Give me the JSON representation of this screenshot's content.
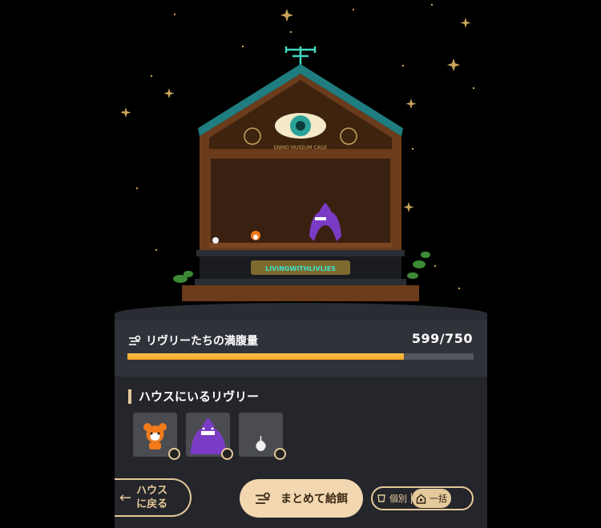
{
  "scene": {
    "sign_text": "LIVINGWITHLIVLIES",
    "house_header_text": "ENMEI MUSEUM CAGE"
  },
  "satiety": {
    "label": "リヴリーたちの満腹量",
    "value_text": "599/750",
    "current": 599,
    "max": 750,
    "icon": "satiety-lines-icon"
  },
  "house_section": {
    "title": "ハウスにいるリヴリー",
    "livlies": [
      {
        "name": "orange-livly",
        "color": "#f07a1c"
      },
      {
        "name": "purple-livly",
        "color": "#7a3cc4"
      },
      {
        "name": "white-bulb-livly",
        "color": "#f0f0f0"
      }
    ]
  },
  "footer": {
    "back_label_line1": "ハウス",
    "back_label_line2": "に戻る",
    "feed_label": "まとめて給餌",
    "toggle_individual": "個別",
    "toggle_bulk": "一括"
  },
  "colors": {
    "accent": "#e6c99a",
    "bar_fill": "#f5a623",
    "roof": "#1f7d80",
    "wood": "#6b3c1b"
  }
}
